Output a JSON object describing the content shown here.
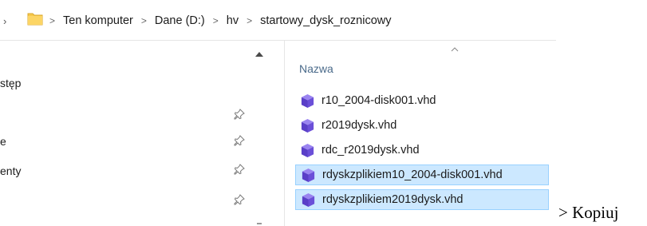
{
  "address_bar": {
    "breadcrumbs": [
      {
        "label": "Ten komputer"
      },
      {
        "label": "Dane (D:)"
      },
      {
        "label": "hv"
      },
      {
        "label": "startowy_dysk_roznicowy"
      }
    ],
    "separator": ">",
    "folder_icon": "folder-icon"
  },
  "nav_pane": {
    "items": [
      {
        "label": "stęp",
        "pinned": false
      },
      {
        "label": "",
        "pinned": true
      },
      {
        "label": "e",
        "pinned": true
      },
      {
        "label": "enty",
        "pinned": true
      },
      {
        "label": "",
        "pinned": true
      }
    ]
  },
  "file_list": {
    "column_header": "Nazwa",
    "sort": "ascending",
    "files": [
      {
        "name": "r10_2004-disk001.vhd",
        "icon": "vhd-icon",
        "selected": false
      },
      {
        "name": "r2019dysk.vhd",
        "icon": "vhd-icon",
        "selected": false
      },
      {
        "name": "rdc_r2019dysk.vhd",
        "icon": "vhd-icon",
        "selected": false
      },
      {
        "name": "rdyskzplikiem10_2004-disk001.vhd",
        "icon": "vhd-icon",
        "selected": true
      },
      {
        "name": "rdyskzplikiem2019dysk.vhd",
        "icon": "vhd-icon",
        "selected": true
      }
    ]
  },
  "trailing_text": "> Kopiuj",
  "colors": {
    "selection_bg": "#cce8ff",
    "selection_border": "#99d1ff",
    "header_text": "#4a6a8a",
    "folder_yellow": "#f7c94b",
    "vhd_purple": "#6b4fd8"
  }
}
